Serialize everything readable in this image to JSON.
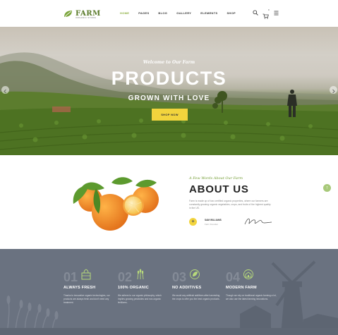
{
  "header": {
    "logo_text": "FARM",
    "logo_sub": "ORGANIC STORE",
    "nav": [
      "HOME",
      "PAGES",
      "BLOG",
      "GALLERY",
      "ELEMENTS",
      "SHOP"
    ],
    "active_nav": "HOME",
    "cart_count": "0"
  },
  "hero": {
    "tagline": "Welcome to Our Farm",
    "title": "PRODUCTS",
    "subtitle": "GROWN WITH LOVE",
    "button": "SHOP NOW"
  },
  "about": {
    "kicker": "A Few Words About Our Farm",
    "title": "ABOUT US",
    "text": "Farm is made up of two certified organic properties, where our farmers are constantly growing organic vegetables, crops, and fruits of the highest quality in the US.",
    "author_name": "SAM WILLIAMS",
    "author_role": "Farm Founder"
  },
  "features": [
    {
      "num": "01",
      "title": "ALWAYS FRESH",
      "text": "Thanks to innovative organic technologies, our products are always fresh and don't need any treatment.",
      "icon": "crate-icon"
    },
    {
      "num": "02",
      "title": "100% ORGANIC",
      "text": "We adhere to our organic philosophy, which implies growing pesticides and non-organic fertilizers.",
      "icon": "wheat-icon"
    },
    {
      "num": "03",
      "title": "NO ADDITIVES",
      "text": "We avoid any artificial additives after harvesting the crops to offer you the best organic products.",
      "icon": "leaf-icon"
    },
    {
      "num": "04",
      "title": "MODERN FARM",
      "text": "Though we rely on traditional organic farming a lot, we also use the latest farming innovations.",
      "icon": "farm-icon"
    }
  ],
  "colors": {
    "accent_green": "#8aae3c",
    "button_yellow": "#f2d43d",
    "features_bg": "#6a7280"
  }
}
